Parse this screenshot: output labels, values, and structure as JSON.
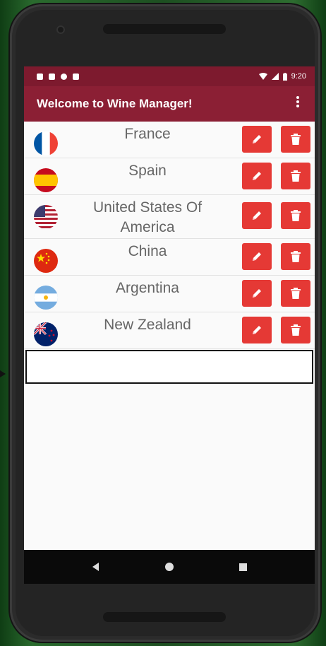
{
  "status_bar": {
    "time": "9:20"
  },
  "app_bar": {
    "title": "Welcome to Wine Manager!",
    "overflow_icon": "more-vert-icon"
  },
  "countries": [
    {
      "name": "France",
      "flag": "france-flag"
    },
    {
      "name": "Spain",
      "flag": "spain-flag"
    },
    {
      "name": "United States Of America",
      "flag": "usa-flag"
    },
    {
      "name": "China",
      "flag": "china-flag"
    },
    {
      "name": "Argentina",
      "flag": "argentina-flag"
    },
    {
      "name": "New Zealand",
      "flag": "new-zealand-flag"
    }
  ],
  "row_actions": {
    "edit_icon": "pencil-icon",
    "delete_icon": "trash-icon"
  },
  "colors": {
    "app_bar": "#8b1f34",
    "status_bar": "#7d1a2e",
    "action_button": "#e53935"
  },
  "nav_bar": {
    "back_icon": "back-triangle-icon",
    "home_icon": "home-circle-icon",
    "recents_icon": "recents-square-icon"
  }
}
